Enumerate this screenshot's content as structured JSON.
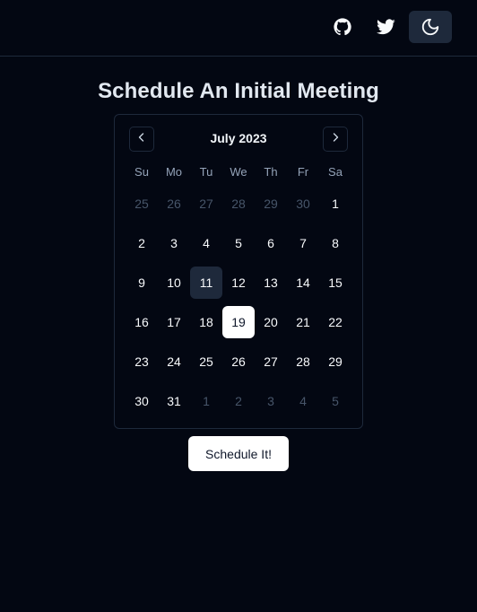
{
  "header": {
    "icons": {
      "github": "github-icon",
      "twitter": "twitter-icon",
      "theme": "moon-icon"
    }
  },
  "page": {
    "title": "Schedule An Initial Meeting"
  },
  "calendar": {
    "month_label": "July 2023",
    "prev_icon": "chevron-left-icon",
    "next_icon": "chevron-right-icon",
    "weekdays": [
      "Su",
      "Mo",
      "Tu",
      "We",
      "Th",
      "Fr",
      "Sa"
    ],
    "days": [
      {
        "label": "25",
        "outside": true
      },
      {
        "label": "26",
        "outside": true
      },
      {
        "label": "27",
        "outside": true
      },
      {
        "label": "28",
        "outside": true
      },
      {
        "label": "29",
        "outside": true
      },
      {
        "label": "30",
        "outside": true
      },
      {
        "label": "1"
      },
      {
        "label": "2"
      },
      {
        "label": "3"
      },
      {
        "label": "4"
      },
      {
        "label": "5"
      },
      {
        "label": "6"
      },
      {
        "label": "7"
      },
      {
        "label": "8"
      },
      {
        "label": "9"
      },
      {
        "label": "10"
      },
      {
        "label": "11",
        "today": true
      },
      {
        "label": "12"
      },
      {
        "label": "13"
      },
      {
        "label": "14"
      },
      {
        "label": "15"
      },
      {
        "label": "16"
      },
      {
        "label": "17"
      },
      {
        "label": "18"
      },
      {
        "label": "19",
        "selected": true
      },
      {
        "label": "20"
      },
      {
        "label": "21"
      },
      {
        "label": "22"
      },
      {
        "label": "23"
      },
      {
        "label": "24"
      },
      {
        "label": "25"
      },
      {
        "label": "26"
      },
      {
        "label": "27"
      },
      {
        "label": "28"
      },
      {
        "label": "29"
      },
      {
        "label": "30"
      },
      {
        "label": "31"
      },
      {
        "label": "1",
        "outside": true
      },
      {
        "label": "2",
        "outside": true
      },
      {
        "label": "3",
        "outside": true
      },
      {
        "label": "4",
        "outside": true
      },
      {
        "label": "5",
        "outside": true
      }
    ]
  },
  "actions": {
    "schedule_label": "Schedule It!"
  },
  "colors": {
    "background": "#030712",
    "border": "#1e293b",
    "muted_text": "#94a3b8",
    "outside_day": "#475569",
    "selected_bg": "#ffffff"
  }
}
